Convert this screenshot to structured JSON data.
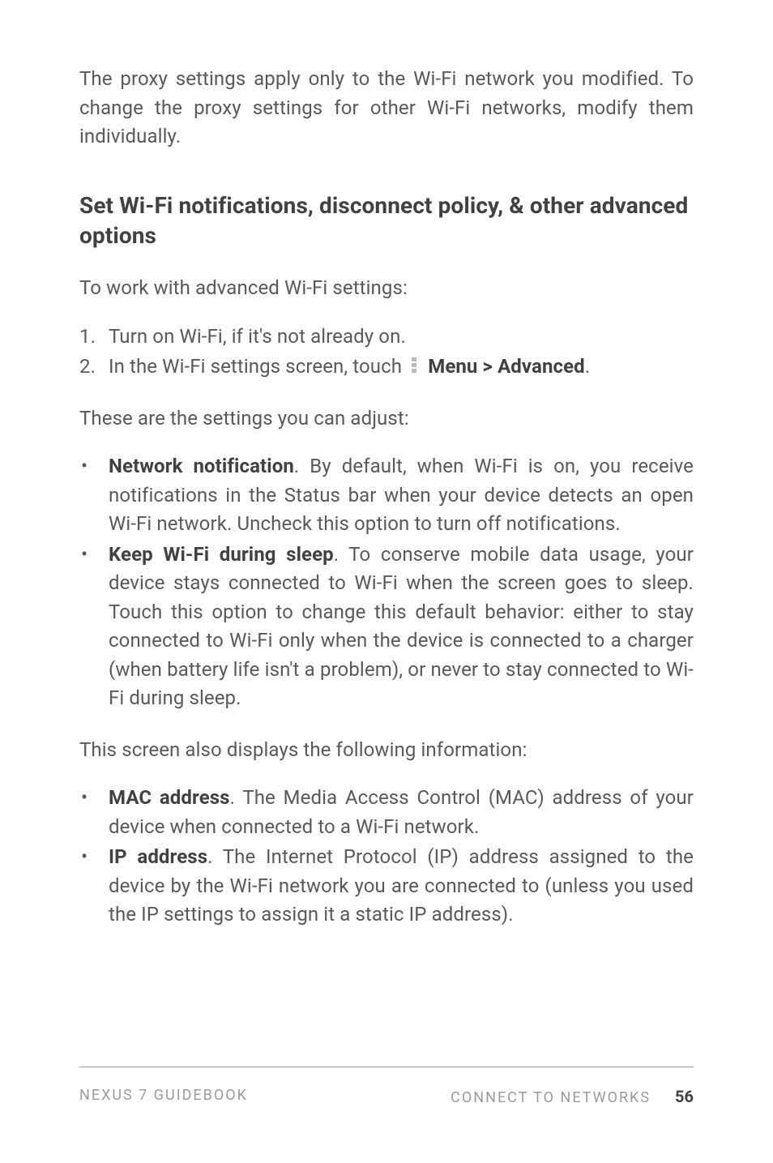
{
  "intro": "The proxy settings apply only to the Wi-Fi network you modified. To change the proxy settings for other Wi-Fi networks, modify them individually.",
  "heading": "Set Wi-Fi notifications, disconnect policy, & other advanced options",
  "lead": "To work with advanced Wi-Fi settings:",
  "steps": {
    "n1": "1.",
    "s1": "Turn on Wi-Fi, if it's not already on.",
    "n2": "2.",
    "s2a": "In the Wi-Fi settings screen, touch ",
    "s2b": "Menu > Advanced",
    "s2c": "."
  },
  "after_steps": "These are the settings you can adjust:",
  "settings": {
    "net_title": "Network notification",
    "net_body": ". By default, when Wi-Fi is on, you re­ceive notifications in the Status bar when your device de­tects an open Wi-Fi network. Uncheck this option to turn off notifications.",
    "keep_title": "Keep Wi-Fi during sleep",
    "keep_body": ". To conserve mobile data usage, your device stays connected to Wi-Fi when the screen goes to sleep. Touch this option to change this default behavior: either to stay connected to Wi-Fi only when the device is connected to a charger (when battery life isn't a problem), or never to stay connected to Wi-Fi during sleep."
  },
  "info_lead": "This screen also displays the following information:",
  "info": {
    "mac_title": "MAC address",
    "mac_body": ". The Media Access Control (MAC) address of your device when connected to a Wi-Fi network.",
    "ip_title": "IP address",
    "ip_body": ". The Internet Protocol (IP) address assigned to the device by the Wi-Fi network you are connected to (unless you used the IP settings to assign it a static IP address)."
  },
  "footer": {
    "left": "NEXUS 7 GUIDEBOOK",
    "right": "CONNECT TO NETWORKS",
    "page": "56"
  }
}
